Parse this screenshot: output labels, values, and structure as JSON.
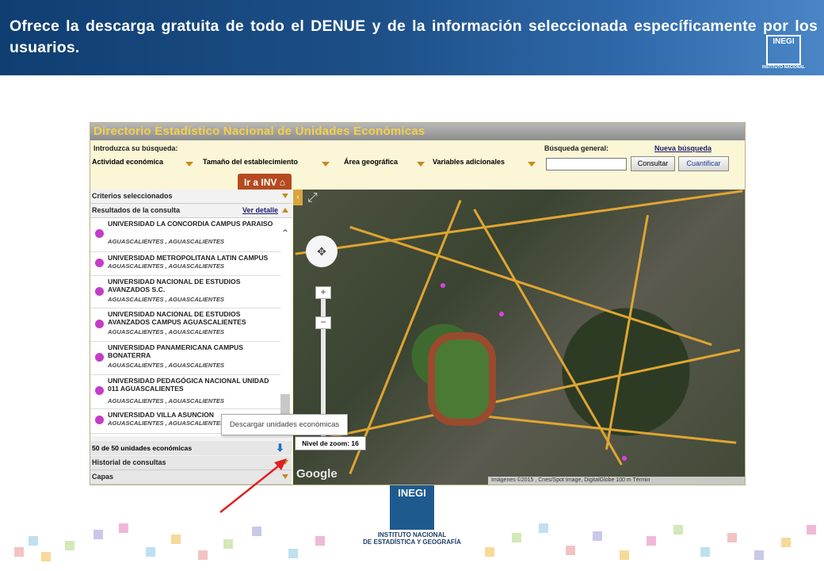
{
  "banner": {
    "text": "Ofrece la descarga gratuita de todo el DENUE y de la información seleccionada específicamente por los usuarios.",
    "logo_mark": "INEGI",
    "logo_sub": "INSTITUTO NACIONAL"
  },
  "app": {
    "title": "Directorio Estadístico Nacional de Unidades Económicas",
    "search_label": "Introduzca su búsqueda:",
    "general_search_label": "Búsqueda general:",
    "new_search": "Nueva búsqueda",
    "filters": [
      "Actividad económica",
      "Tamaño del establecimiento",
      "Área geográfica",
      "Variables adicionales"
    ],
    "consultar": "Consultar",
    "cuantificar": "Cuantificar",
    "ir_inv": "Ir a INV"
  },
  "panel": {
    "criterios": "Criterios seleccionados",
    "resultados": "Resultados de la consulta",
    "ver_detalle": "Ver detalle",
    "results": [
      {
        "name": "UNIVERSIDAD LA CONCORDIA CAMPUS PARAISO",
        "loc": "AGUASCALIENTES , AGUASCALIENTES"
      },
      {
        "name": "UNIVERSIDAD METROPOLITANA LATIN CAMPUS",
        "loc": "AGUASCALIENTES , AGUASCALIENTES"
      },
      {
        "name": "UNIVERSIDAD NACIONAL DE ESTUDIOS AVANZADOS S.C.",
        "loc": "AGUASCALIENTES , AGUASCALIENTES"
      },
      {
        "name": "UNIVERSIDAD NACIONAL DE ESTUDIOS AVANZADOS CAMPUS AGUASCALIENTES",
        "loc": "AGUASCALIENTES , AGUASCALIENTES"
      },
      {
        "name": "UNIVERSIDAD PANAMERICANA CAMPUS BONATERRA",
        "loc": "AGUASCALIENTES , AGUASCALIENTES"
      },
      {
        "name": "UNIVERSIDAD PEDAGÓGICA NACIONAL UNIDAD 011 AGUASCALIENTES",
        "loc": "AGUASCALIENTES , AGUASCALIENTES"
      },
      {
        "name": "UNIVERSIDAD VILLA ASUNCION",
        "loc": "AGUASCALIENTES , AGUASCALIENTES"
      }
    ],
    "count": "50 de 50 unidades económicas",
    "tooltip": "Descargar unidades económicas",
    "historial": "Historial de consultas",
    "capas": "Capas"
  },
  "map": {
    "zoom_label": "Nivel de zoom: 16",
    "google": "Google",
    "attribution": "Imágenes ©2015 , Cnes/Spot Image, DigitalGlobe   100 m   Términ"
  },
  "footer": {
    "logo_mark": "INEGI",
    "line1": "INSTITUTO NACIONAL",
    "line2": "DE ESTADÍSTICA Y GEOGRAFÍA"
  },
  "colors": {
    "accent": "#c98a1b",
    "pin": "#e040e6",
    "arrow": "#e02020"
  }
}
